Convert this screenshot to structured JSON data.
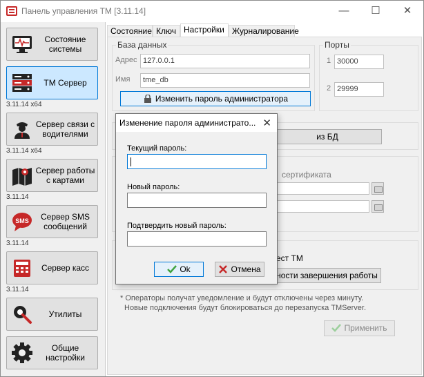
{
  "window": {
    "title": "Панель управления TM [3.11.14]"
  },
  "titlebar_buttons": {
    "minimize": "—",
    "maximize": "☐",
    "close": "✕"
  },
  "sidebar": {
    "items": [
      {
        "label": "Состояние системы",
        "icon": "monitor-pulse-icon"
      },
      {
        "label": "TM Сервер",
        "icon": "server-rack-icon",
        "version": "3.11.14 x64"
      },
      {
        "label": "Сервер связи с водителями",
        "icon": "driver-icon",
        "version": "3.11.14 x64"
      },
      {
        "label": "Сервер работы с картами",
        "icon": "map-pin-icon",
        "version": "3.11.14"
      },
      {
        "label": "Сервер SMS сообщений",
        "icon": "sms-icon",
        "version": "3.11.14"
      },
      {
        "label": "Сервер касс",
        "icon": "cash-register-icon",
        "version": "3.11.14"
      },
      {
        "label": "Утилиты",
        "icon": "wrench-gear-icon"
      },
      {
        "label": "Общие настройки",
        "icon": "gear-icon"
      }
    ]
  },
  "tabs": [
    "Состояние",
    "Ключ",
    "Настройки",
    "Журналирование"
  ],
  "database": {
    "title": "База данных",
    "address_label": "Адрес",
    "address_value": "127.0.0.1",
    "name_label": "Имя",
    "name_value": "tme_db",
    "change_password_button": "Изменить пароль администратора"
  },
  "ports": {
    "title": "Порты",
    "port1_label": "1",
    "port1_value": "30000",
    "port2_label": "2",
    "port2_value": "29999"
  },
  "background_fragments": {
    "db_button_partial": "из БД",
    "certificate_partial": "сертификата",
    "tm_partial": "ест TM",
    "shutdown_button_partial": "ности завершения работы"
  },
  "note": {
    "line1": "* Операторы получат уведомление и будут отключены через минуту.",
    "line2": "Новые подключения будут блокироваться до перезапуска TMServer."
  },
  "apply_button": "Применить",
  "dialog": {
    "title": "Изменение пароля администрато...",
    "close": "✕",
    "current_password_label": "Текущий пароль:",
    "new_password_label": "Новый пароль:",
    "confirm_password_label": "Подтвердить новый пароль:",
    "ok_button": "Ok",
    "cancel_button": "Отмена"
  },
  "colors": {
    "accent": "#0078d7",
    "selected_bg": "#cce8ff",
    "brand_red": "#c62828",
    "ok_green": "#3fa33f"
  }
}
